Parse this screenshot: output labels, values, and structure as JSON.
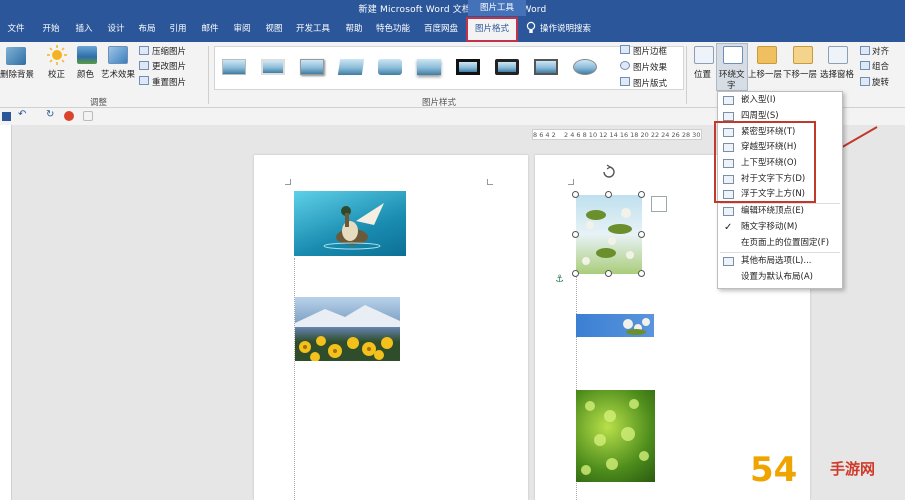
{
  "window": {
    "title": "新建 Microsoft Word 文档 (2).docx  -  Word",
    "contextual_tag": "图片工具"
  },
  "tabs": [
    {
      "label": "文件"
    },
    {
      "label": "开始"
    },
    {
      "label": "插入"
    },
    {
      "label": "设计"
    },
    {
      "label": "布局"
    },
    {
      "label": "引用"
    },
    {
      "label": "邮件"
    },
    {
      "label": "审阅"
    },
    {
      "label": "视图"
    },
    {
      "label": "开发工具"
    },
    {
      "label": "帮助"
    },
    {
      "label": "特色功能"
    },
    {
      "label": "百度网盘"
    }
  ],
  "active_tab": "图片格式",
  "search_label": "操作说明搜索",
  "ribbon": {
    "adjust": {
      "remove_bg": "删除背景",
      "correct": "校正",
      "color": "颜色",
      "art_effect": "艺术效果",
      "compress": "压缩图片",
      "change": "更改图片",
      "reset": "重置图片",
      "group_name": "调整"
    },
    "styles": {
      "group_name": "图片样式",
      "border": "图片边框",
      "effect": "图片效果",
      "layout": "图片版式"
    },
    "arrange": {
      "position": "位置",
      "wrap_text_1": "环绕文",
      "wrap_text_2": "字",
      "bring_forward": "上移一层",
      "send_backward": "下移一层",
      "selection_pane": "选择窗格",
      "align": "对齐",
      "group": "组合",
      "rotate": "旋转"
    }
  },
  "wrap_menu": {
    "items": [
      {
        "label": "嵌入型(I)"
      },
      {
        "label": "四周型(S)"
      },
      {
        "label": "紧密型环绕(T)"
      },
      {
        "label": "穿越型环绕(H)"
      },
      {
        "label": "上下型环绕(O)"
      },
      {
        "label": "衬于文字下方(D)"
      },
      {
        "label": "浮于文字上方(N)"
      },
      {
        "label": "编辑环绕顶点(E)"
      },
      {
        "label": "随文字移动(M)"
      },
      {
        "label": "在页面上的位置固定(F)"
      },
      {
        "label": "其他布局选项(L)..."
      },
      {
        "label": "设置为默认布局(A)"
      }
    ]
  },
  "ruler_numbers": "8 6 4 2    2 4 6 8 10 12 14 16 18 20 22 24 26 28 30 32",
  "watermark_text": "手游网",
  "watermark_num": "54"
}
